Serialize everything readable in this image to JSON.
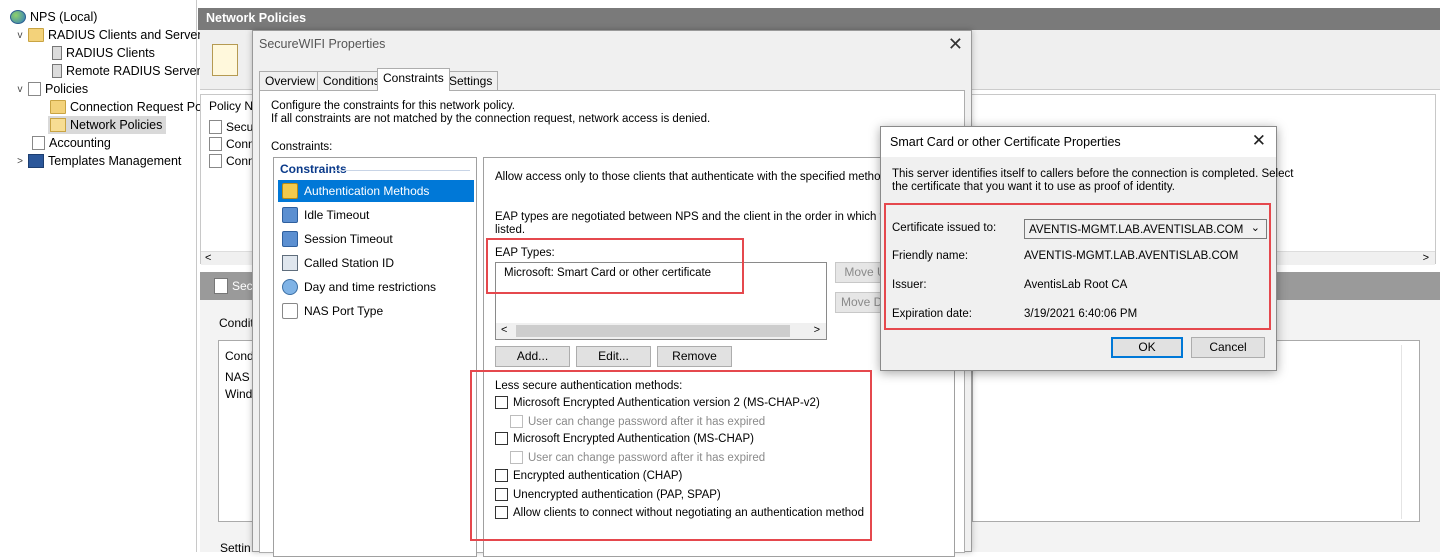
{
  "tree": {
    "root": "NPS (Local)",
    "items": [
      {
        "label": "RADIUS Clients and Servers",
        "expander": "v"
      },
      {
        "label": "RADIUS Clients"
      },
      {
        "label": "Remote RADIUS Server"
      },
      {
        "label": "Policies",
        "expander": "v"
      },
      {
        "label": "Connection Request Po"
      },
      {
        "label": "Network Policies"
      },
      {
        "label": "Accounting"
      },
      {
        "label": "Templates Management",
        "expander": ">"
      }
    ]
  },
  "main": {
    "header": "Network Policies",
    "policy_col": "Policy Na",
    "rows": [
      "Secu",
      "Conn",
      "Conn"
    ],
    "sec_label": "Sec",
    "conditions_label": "Conditi",
    "cond_col": [
      "Cond",
      "NAS",
      "Wind"
    ],
    "settings_label": "Settin"
  },
  "props": {
    "title": "SecureWIFI Properties",
    "close": "✕",
    "tabs": [
      "Overview",
      "Conditions",
      "Constraints",
      "Settings"
    ],
    "intro_line1": "Configure the constraints for this network policy.",
    "intro_line2": "If all constraints are not matched by the connection request, network access is denied.",
    "constraints_label": "Constraints:",
    "list_header": "Constraints",
    "list_items": [
      "Authentication Methods",
      "Idle Timeout",
      "Session Timeout",
      "Called Station ID",
      "Day and time restrictions",
      "NAS Port Type"
    ],
    "pane": {
      "allow_text": "Allow access only to those clients that authenticate with the specified methods.",
      "eap_note_1": "EAP types are negotiated between NPS and the client in the order in which they a",
      "eap_note_2": "listed.",
      "eap_types_label": "EAP Types:",
      "eap_item": "Microsoft: Smart Card or other certificate",
      "move_up": "Move U",
      "move_down": "Move Do",
      "add": "Add...",
      "edit": "Edit...",
      "remove": "Remove",
      "less_secure": "Less secure authentication methods:",
      "checks": [
        {
          "label": "Microsoft Encrypted Authentication version 2 (MS-CHAP-v2)",
          "checked": false,
          "disabled": false
        },
        {
          "label": "User can change password after it has expired",
          "checked": false,
          "disabled": true
        },
        {
          "label": "Microsoft Encrypted Authentication (MS-CHAP)",
          "checked": false,
          "disabled": false
        },
        {
          "label": "User can change password after it has expired",
          "checked": false,
          "disabled": true
        },
        {
          "label": "Encrypted authentication (CHAP)",
          "checked": false,
          "disabled": false
        },
        {
          "label": "Unencrypted authentication (PAP, SPAP)",
          "checked": false,
          "disabled": false
        },
        {
          "label": "Allow clients to connect without negotiating an authentication method",
          "checked": false,
          "disabled": false
        }
      ]
    }
  },
  "smartcard": {
    "title": "Smart Card or other Certificate Properties",
    "close": "✕",
    "desc_line1": "This server identifies itself to callers before the connection is completed. Select",
    "desc_line2": "the certificate that you want it to use as proof of identity.",
    "cert_label": "Certificate issued to:",
    "cert_value": "AVENTIS-MGMT.LAB.AVENTISLAB.COM",
    "friendly_label": "Friendly name:",
    "friendly_value": "AVENTIS-MGMT.LAB.AVENTISLAB.COM",
    "issuer_label": "Issuer:",
    "issuer_value": "AventisLab Root CA",
    "expiration_label": "Expiration date:",
    "expiration_value": "3/19/2021 6:40:06 PM",
    "ok": "OK",
    "cancel": "Cancel"
  },
  "colors": {
    "highlight": "#e5484d",
    "selection": "#0078d7"
  }
}
